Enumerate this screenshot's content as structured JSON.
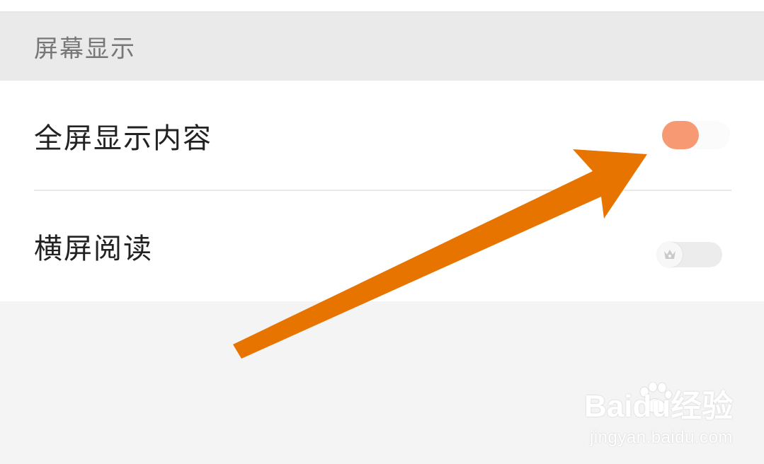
{
  "section": {
    "title": "屏幕显示"
  },
  "settings": [
    {
      "label": "全屏显示内容",
      "state": "on"
    },
    {
      "label": "横屏阅读",
      "state": "off",
      "locked_icon": "crown-icon"
    }
  ],
  "colors": {
    "toggle_on": "#f79a74",
    "annotation_arrow": "#e87400",
    "header_bg": "#eaeaea",
    "card_bg": "#ffffff"
  },
  "watermark": {
    "logo": "Baidu经验",
    "url": "jingyan.baidu.com"
  }
}
